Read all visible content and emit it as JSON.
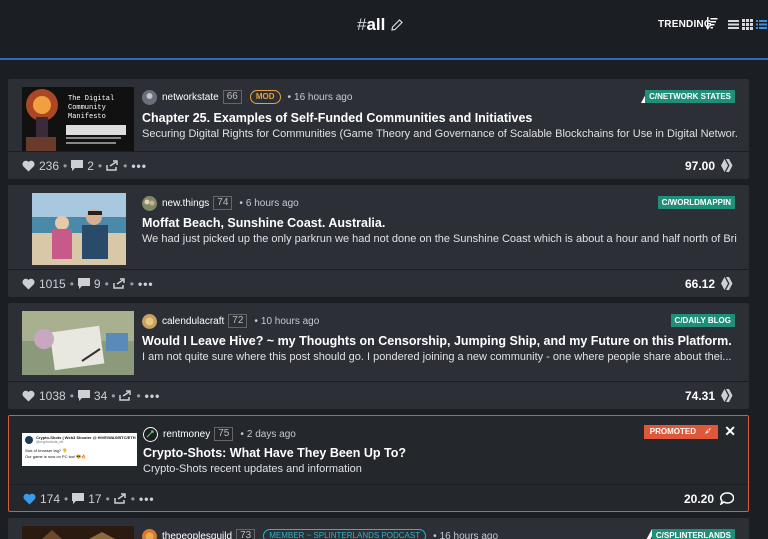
{
  "header": {
    "hash": "#",
    "tag": "all",
    "trending_label": "TRENDING"
  },
  "posts": [
    {
      "author": "networkstate",
      "reputation": "66",
      "badge": "MOD",
      "time": "16 hours ago",
      "community": "C/NETWORK STATES",
      "title": "Chapter 25. Examples of Self-Funded Communities and Initiatives",
      "summary": "Securing Digital Rights for Communities (Game Theory and Governance of Scalable Blockchains for Use in Digital Networ...",
      "votes": "236",
      "comments": "2",
      "payout": "97.00",
      "thumb_text": "The Digital Community Manifesto"
    },
    {
      "author": "new.things",
      "reputation": "74",
      "time": "6 hours ago",
      "community": "C/WORLDMAPPIN",
      "title": "Moffat Beach, Sunshine Coast. Australia.",
      "summary": "We had just picked up the only parkrun we had not done on the Sunshine Coast which is about a hour and half north of Bri",
      "votes": "1015",
      "comments": "9",
      "payout": "66.12"
    },
    {
      "author": "calendulacraft",
      "reputation": "72",
      "time": "10 hours ago",
      "community": "C/DAILY BLOG",
      "title": "Would I Leave Hive? ~ my Thoughts on Censorship, Jumping Ship, and my Future on this Platform.",
      "summary": "I am not quite sure where this post should go. I pondered joining a new community - one where people share about thei...",
      "votes": "1038",
      "comments": "34",
      "payout": "74.31"
    },
    {
      "author": "rentmoney",
      "reputation": "75",
      "time": "2 days ago",
      "promoted_label": "PROMOTED",
      "title": "Crypto-Shots: What Have They Been Up To?",
      "summary": "Crypto-Shots recent updates and information",
      "votes": "174",
      "comments": "17",
      "payout": "20.20",
      "thumb_heading": "Crypto-Shots | Web3 Shooter @ HIVE/WAX/BTC/ETH",
      "thumb_handle": "@cryptoshots_nft",
      "thumb_line1": "Sick of browser lag? 👎",
      "thumb_line2": "Our game is now on PC too! 😎🔥"
    },
    {
      "author": "thepeoplesguild",
      "reputation": "73",
      "badge": "MEMBER ~ SPLINTERLANDS PODCAST",
      "time": "16 hours ago",
      "community": "C/SPLINTERLANDS"
    }
  ],
  "colors": {
    "accent_blue": "#2a6fb8",
    "community_green": "#1f8f7a",
    "promoted": "#e0583a",
    "mod_orange": "#e8a13a"
  }
}
